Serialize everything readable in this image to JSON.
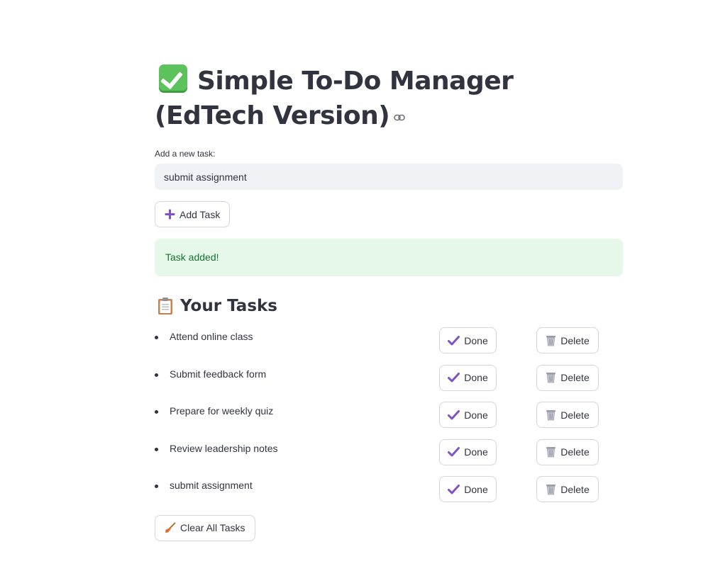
{
  "page": {
    "title": "Simple To-Do Manager (EdTech Version)"
  },
  "input": {
    "label": "Add a new task:",
    "value": "submit assignment"
  },
  "add_button": {
    "label": "Add Task"
  },
  "alert": {
    "message": "Task added!"
  },
  "tasks_section": {
    "header": "Your Tasks",
    "tasks": [
      {
        "text": "Attend online class",
        "done_label": "Done",
        "delete_label": "Delete"
      },
      {
        "text": "Submit feedback form",
        "done_label": "Done",
        "delete_label": "Delete"
      },
      {
        "text": "Prepare for weekly quiz",
        "done_label": "Done",
        "delete_label": "Delete"
      },
      {
        "text": "Review leadership notes",
        "done_label": "Done",
        "delete_label": "Delete"
      },
      {
        "text": "submit assignment",
        "done_label": "Done",
        "delete_label": "Delete"
      }
    ]
  },
  "clear_button": {
    "label": "Clear All Tasks"
  },
  "colors": {
    "text": "#31333f",
    "accent_purple": "#7d53c6",
    "success_bg": "#e6f8ea",
    "success_text": "#177233",
    "input_bg": "#f0f2f6"
  },
  "icons": {
    "title": "white-check-mark-emoji",
    "header_link": "link-icon",
    "add": "plus-icon",
    "section": "clipboard-icon",
    "done": "checkmark-icon",
    "delete": "wastebasket-icon",
    "clear": "broom-icon"
  }
}
